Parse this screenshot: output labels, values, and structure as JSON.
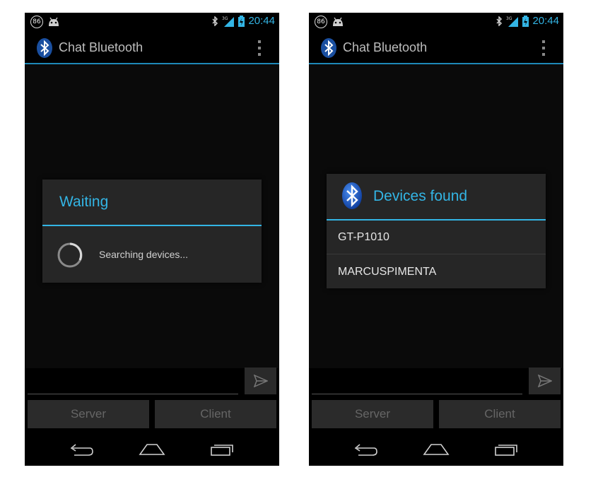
{
  "status_bar": {
    "notification_count": "86",
    "time": "20:44",
    "network": "3G"
  },
  "app": {
    "title": "Chat Bluetooth"
  },
  "buttons": {
    "server": "Server",
    "client": "Client"
  },
  "waiting_dialog": {
    "title": "Waiting",
    "message": "Searching devices..."
  },
  "devices_dialog": {
    "title": "Devices found",
    "devices": [
      "GT-P1010",
      "MARCUSPIMENTA"
    ]
  },
  "colors": {
    "accent": "#33b5e5",
    "background": "#000000",
    "dialog": "#262626"
  }
}
